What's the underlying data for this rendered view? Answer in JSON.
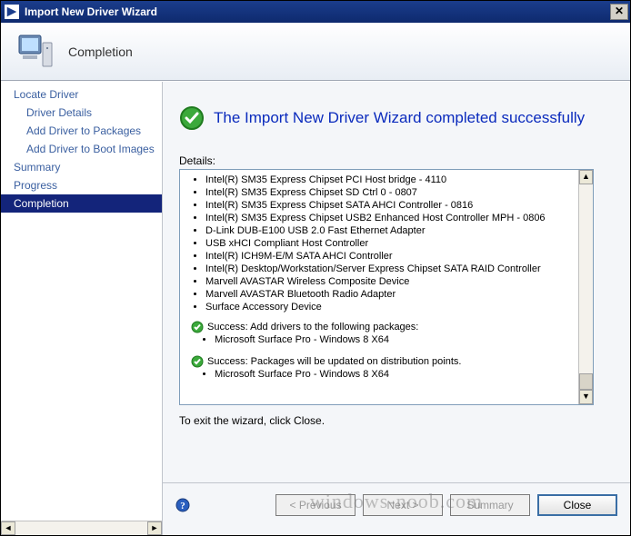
{
  "titlebar": {
    "title": "Import New Driver Wizard"
  },
  "header": {
    "page_title": "Completion"
  },
  "sidebar": {
    "items": [
      {
        "label": "Locate Driver",
        "child": false
      },
      {
        "label": "Driver Details",
        "child": true
      },
      {
        "label": "Add Driver to Packages",
        "child": true
      },
      {
        "label": "Add Driver to Boot Images",
        "child": true
      },
      {
        "label": "Summary",
        "child": false
      },
      {
        "label": "Progress",
        "child": false
      },
      {
        "label": "Completion",
        "child": false,
        "selected": true
      }
    ]
  },
  "content": {
    "success_message": "The Import New Driver Wizard completed successfully",
    "details_label": "Details:",
    "driver_list": [
      "Intel(R) SM35 Express Chipset PCI Host bridge - 4110",
      "Intel(R) SM35 Express Chipset SD Ctrl 0 - 0807",
      "Intel(R) SM35 Express Chipset SATA AHCI Controller - 0816",
      "Intel(R) SM35 Express Chipset USB2 Enhanced Host Controller MPH - 0806",
      "D-Link DUB-E100 USB 2.0 Fast Ethernet Adapter",
      "USB xHCI Compliant Host Controller",
      "Intel(R) ICH9M-E/M SATA AHCI Controller",
      "Intel(R) Desktop/Workstation/Server Express Chipset SATA RAID Controller",
      "Marvell AVASTAR Wireless Composite Device",
      "Marvell AVASTAR Bluetooth Radio Adapter",
      "Surface Accessory Device"
    ],
    "status1": {
      "text": "Success: Add drivers to the following packages:",
      "items": [
        "Microsoft Surface Pro - Windows 8 X64"
      ]
    },
    "status2": {
      "text": "Success: Packages will be updated on distribution points.",
      "items": [
        "Microsoft Surface Pro - Windows 8 X64"
      ]
    },
    "exit_text": "To exit the wizard, click Close."
  },
  "buttons": {
    "previous": "< Previous",
    "next": "Next >",
    "summary": "Summary",
    "close": "Close"
  },
  "watermark": "windows-noob.com"
}
